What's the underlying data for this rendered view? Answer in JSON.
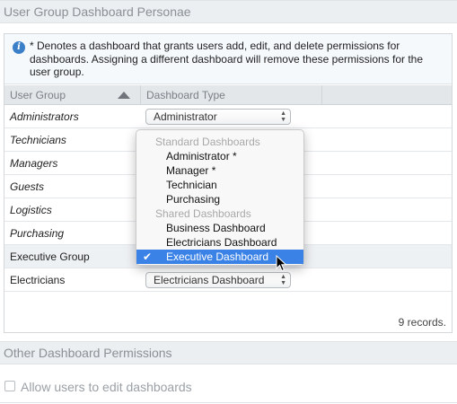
{
  "section1": {
    "title": "User Group Dashboard Personae"
  },
  "info": {
    "icon": "info-icon",
    "text": "* Denotes a dashboard that grants users add, edit, and delete permissions for dashboards. Assigning a different dashboard will remove these permissions for the user group."
  },
  "grid": {
    "columns": {
      "group": "User Group",
      "dashboard": "Dashboard Type"
    },
    "rows": [
      {
        "group": "Administrators",
        "dashboard": "Administrator"
      },
      {
        "group": "Technicians",
        "dashboard": ""
      },
      {
        "group": "Managers",
        "dashboard": ""
      },
      {
        "group": "Guests",
        "dashboard": ""
      },
      {
        "group": "Logistics",
        "dashboard": ""
      },
      {
        "group": "Purchasing",
        "dashboard": ""
      },
      {
        "group": "Executive Group",
        "dashboard": ""
      },
      {
        "group": "Electricians",
        "dashboard": "Electricians Dashboard"
      }
    ],
    "records": "9 records."
  },
  "dropdown": {
    "group1": "Standard Dashboards",
    "options1": [
      "Administrator *",
      "Manager *",
      "Technician",
      "Purchasing"
    ],
    "group2": "Shared Dashboards",
    "options2": [
      "Business Dashboard",
      "Electricians Dashboard",
      "Executive Dashboard"
    ],
    "selected": "Executive Dashboard",
    "selected_color": "#3b82e6"
  },
  "section2": {
    "title": "Other Dashboard Permissions"
  },
  "permissions": {
    "allow_edit_label": "Allow users to edit dashboards",
    "allow_edit_checked": false
  }
}
